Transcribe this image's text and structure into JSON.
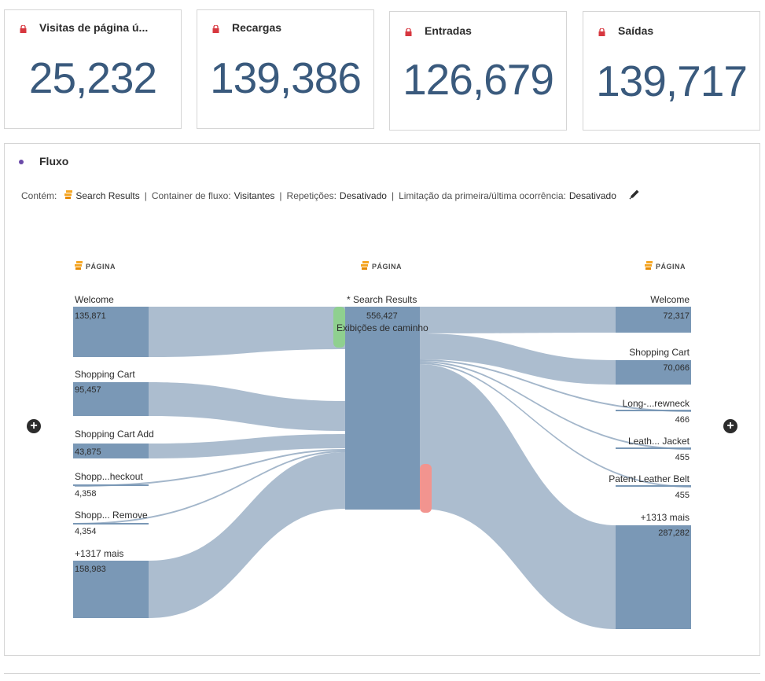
{
  "kpis": [
    {
      "title": "Visitas de página ú...",
      "value": "25,232"
    },
    {
      "title": "Recargas",
      "value": "139,386"
    },
    {
      "title": "Entradas",
      "value": "126,679"
    },
    {
      "title": "Saídas",
      "value": "139,717"
    }
  ],
  "flow": {
    "title": "Fluxo",
    "filters": {
      "contains_label": "Contém:",
      "contains_value": "Search Results",
      "container_label": "Container de fluxo:",
      "container_value": "Visitantes",
      "repeats_label": "Repetições:",
      "repeats_value": "Desativado",
      "limit_label": "Limitação da primeira/última ocorrência:",
      "limit_value": "Desativado"
    },
    "column_header": "PÁGINA",
    "left_nodes": [
      {
        "label": "Welcome",
        "value": "135,871"
      },
      {
        "label": "Shopping Cart",
        "value": "95,457"
      },
      {
        "label": "Shopping Cart Add",
        "value": "43,875"
      },
      {
        "label": "Shopp...heckout",
        "value": "4,358"
      },
      {
        "label": "Shopp... Remove",
        "value": "4,354"
      },
      {
        "label": "+1317 mais",
        "value": "158,983"
      }
    ],
    "center_node": {
      "label": "* Search Results",
      "value": "556,427",
      "sublabel": "Exibições de caminho"
    },
    "right_nodes": [
      {
        "label": "Welcome",
        "value": "72,317"
      },
      {
        "label": "Shopping Cart",
        "value": "70,066"
      },
      {
        "label": "Long-...rewneck",
        "value": "466"
      },
      {
        "label": "Leath... Jacket",
        "value": "455"
      },
      {
        "label": "Patent Leather Belt",
        "value": "455"
      },
      {
        "label": "+1313 mais",
        "value": "287,282"
      }
    ],
    "plus_symbol": "+",
    "colors": {
      "node": "#7a98b6",
      "link": "#a3b6ca",
      "entry": "#8fd08f",
      "exit": "#f2948f",
      "accent": "#3a5a7d"
    }
  }
}
